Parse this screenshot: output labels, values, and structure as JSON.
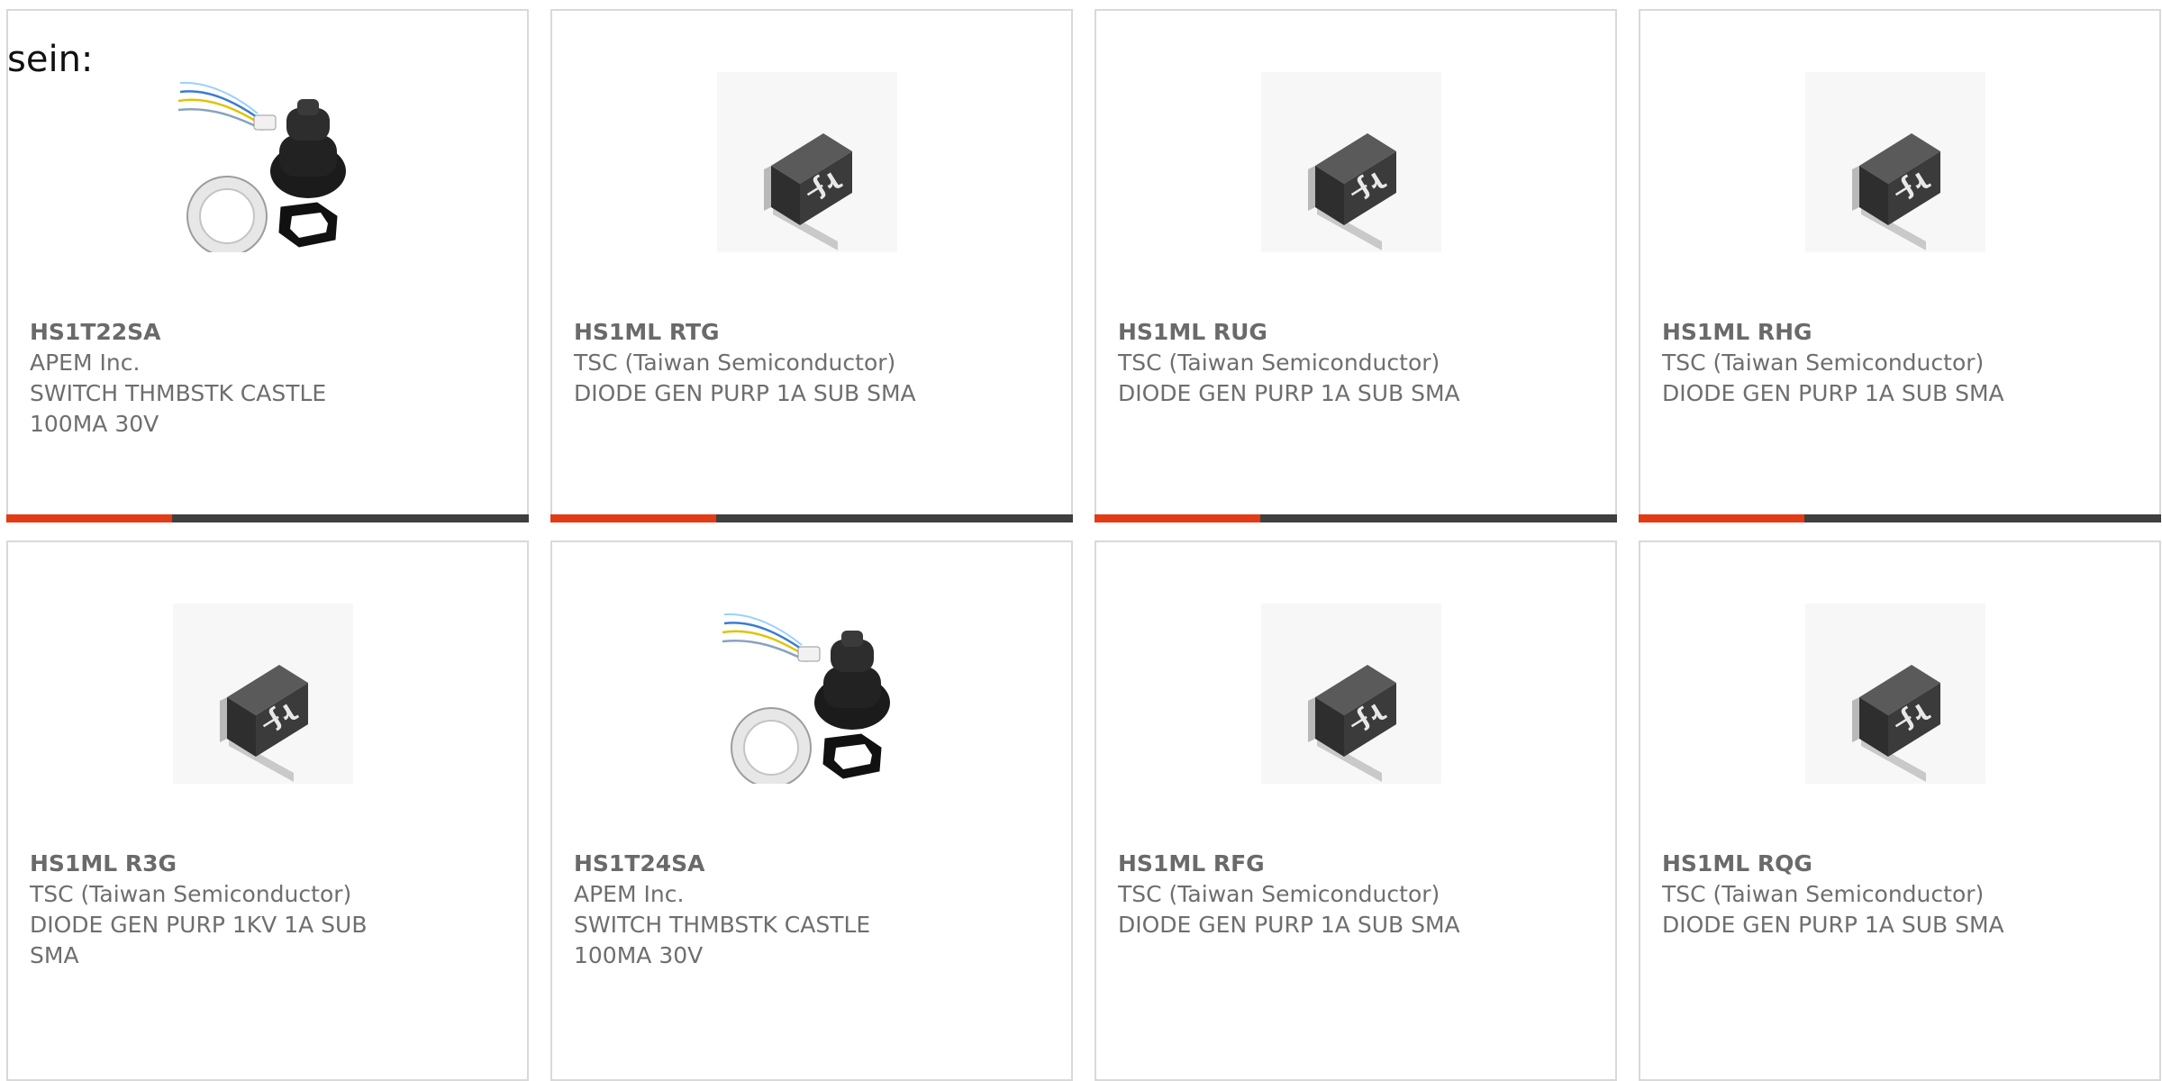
{
  "lead_text": "sein:",
  "products": [
    {
      "part_number": "HS1T22SA",
      "manufacturer": "APEM Inc.",
      "description": "SWITCH THMBSTK CASTLE 100MA 30V",
      "image": "thumbstick-switch-image",
      "accent_color": "#e23b16"
    },
    {
      "part_number": "HS1ML RTG",
      "manufacturer": "TSC (Taiwan Semiconductor)",
      "description": "DIODE GEN PURP 1A SUB SMA",
      "image": "sma-diode-image",
      "accent_color": "#e23b16"
    },
    {
      "part_number": "HS1ML RUG",
      "manufacturer": "TSC (Taiwan Semiconductor)",
      "description": "DIODE GEN PURP 1A SUB SMA",
      "image": "sma-diode-image",
      "accent_color": "#e23b16"
    },
    {
      "part_number": "HS1ML RHG",
      "manufacturer": "TSC (Taiwan Semiconductor)",
      "description": "DIODE GEN PURP 1A SUB SMA",
      "image": "sma-diode-image",
      "accent_color": "#e23b16"
    },
    {
      "part_number": "HS1ML R3G",
      "manufacturer": "TSC (Taiwan Semiconductor)",
      "description": "DIODE GEN PURP 1KV 1A SUB SMA",
      "image": "sma-diode-image"
    },
    {
      "part_number": "HS1T24SA",
      "manufacturer": "APEM Inc.",
      "description": "SWITCH THMBSTK CASTLE 100MA 30V",
      "image": "thumbstick-switch-image"
    },
    {
      "part_number": "HS1ML RFG",
      "manufacturer": "TSC (Taiwan Semiconductor)",
      "description": "DIODE GEN PURP 1A SUB SMA",
      "image": "sma-diode-image"
    },
    {
      "part_number": "HS1ML RQG",
      "manufacturer": "TSC (Taiwan Semiconductor)",
      "description": "DIODE GEN PURP 1A SUB SMA",
      "image": "sma-diode-image"
    }
  ]
}
